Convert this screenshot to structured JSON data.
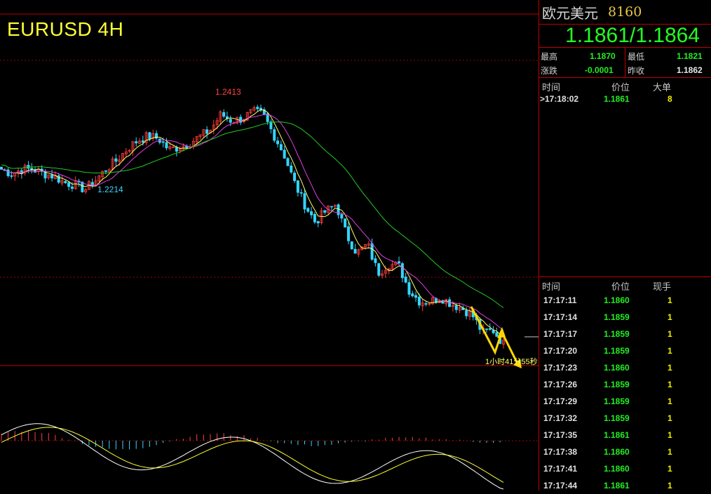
{
  "chart": {
    "title": "EURUSD 4H",
    "high_label": "1.2413",
    "low_label": "1.2214",
    "countdown": "1小时41分55秒"
  },
  "chart_data": {
    "type": "candlestick",
    "title": "EURUSD 4H",
    "annotated_high": 1.2413,
    "annotated_low": 1.2214,
    "close_path": [
      1.226,
      1.225,
      1.226,
      1.226,
      1.225,
      1.2245,
      1.223,
      1.2225,
      1.2214,
      1.2235,
      1.226,
      1.228,
      1.2305,
      1.2325,
      1.2335,
      1.233,
      1.2305,
      1.231,
      1.232,
      1.2335,
      1.235,
      1.2385,
      1.237,
      1.2375,
      1.239,
      1.2385,
      1.234,
      1.2295,
      1.223,
      1.218,
      1.214,
      1.2165,
      1.218,
      1.211,
      1.207,
      1.209,
      1.2025,
      1.2045,
      1.204,
      1.1985,
      1.196,
      1.196,
      1.197,
      1.1955,
      1.1945,
      1.193,
      1.189,
      1.1895,
      1.1864
    ],
    "ma_lines": [
      "yellow",
      "magenta",
      "green"
    ],
    "macd_panel": true,
    "macd_colors": {
      "positive": "#ff4040",
      "negative": "#33d6ff",
      "dif": "#ffffff",
      "dea": "#ffff33"
    }
  },
  "panel": {
    "name": "欧元美元",
    "code": "8160",
    "bid_ask": "1.1861/1.1864",
    "stats": {
      "high_label": "最高",
      "high_value": "1.1870",
      "low_label": "最低",
      "low_value": "1.1821",
      "change_label": "涨跌",
      "change_value": "-0.0001",
      "prev_close_label": "昨收",
      "prev_close_value": "1.1862"
    },
    "big_orders": {
      "headers": {
        "time": "时间",
        "price": "价位",
        "size": "大单"
      },
      "rows": [
        {
          "time": ">17:18:02",
          "price": "1.1861",
          "size": "8"
        }
      ]
    },
    "ticks": {
      "headers": {
        "time": "时间",
        "price": "价位",
        "size": "现手"
      },
      "rows": [
        {
          "time": "17:17:11",
          "price": "1.1860",
          "size": "1"
        },
        {
          "time": "17:17:14",
          "price": "1.1859",
          "size": "1"
        },
        {
          "time": "17:17:17",
          "price": "1.1859",
          "size": "1"
        },
        {
          "time": "17:17:20",
          "price": "1.1859",
          "size": "1"
        },
        {
          "time": "17:17:23",
          "price": "1.1860",
          "size": "1"
        },
        {
          "time": "17:17:26",
          "price": "1.1859",
          "size": "1"
        },
        {
          "time": "17:17:29",
          "price": "1.1859",
          "size": "1"
        },
        {
          "time": "17:17:32",
          "price": "1.1859",
          "size": "1"
        },
        {
          "time": "17:17:35",
          "price": "1.1861",
          "size": "1"
        },
        {
          "time": "17:17:38",
          "price": "1.1860",
          "size": "1"
        },
        {
          "time": "17:17:41",
          "price": "1.1860",
          "size": "1"
        },
        {
          "time": "17:17:44",
          "price": "1.1861",
          "size": "1"
        }
      ]
    }
  }
}
